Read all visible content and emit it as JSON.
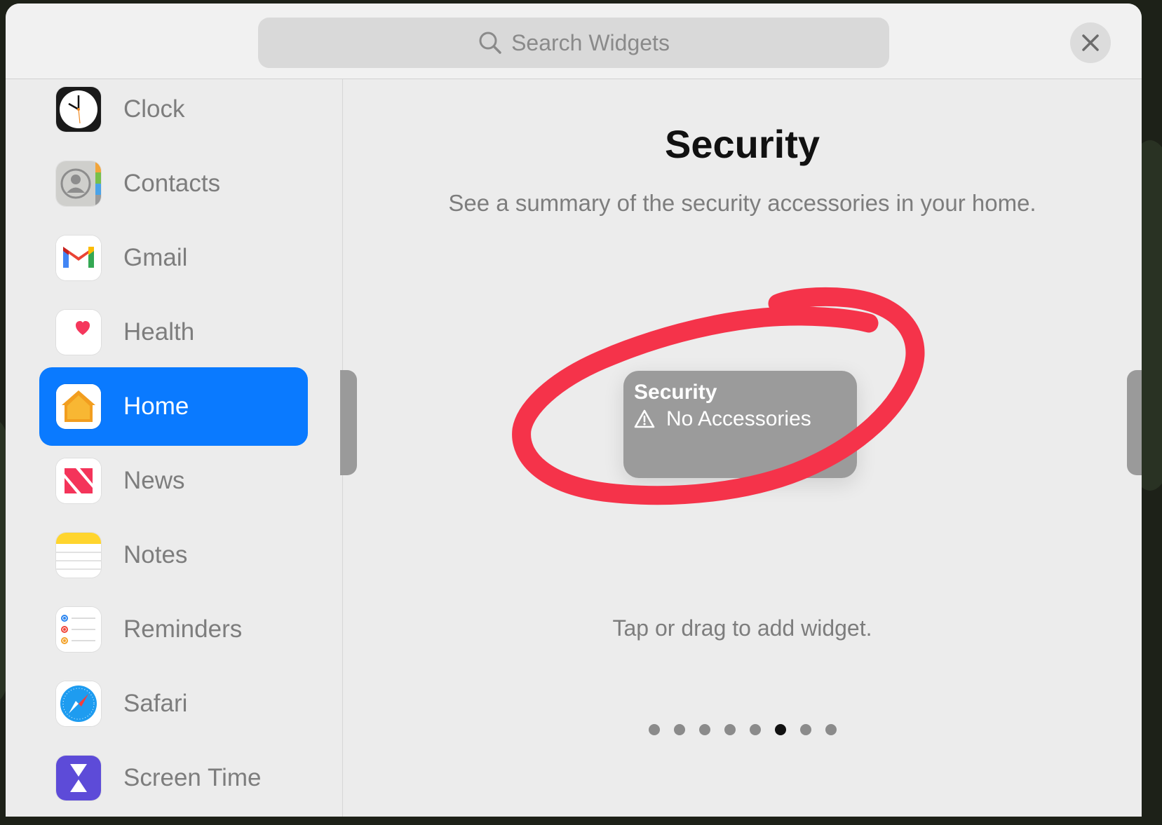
{
  "search": {
    "placeholder": "Search Widgets",
    "icon": "magnifying-glass"
  },
  "close_icon": "xmark",
  "sidebar": {
    "items": [
      {
        "label": "Clock",
        "icon": "clock-app-icon"
      },
      {
        "label": "Contacts",
        "icon": "contacts-app-icon"
      },
      {
        "label": "Gmail",
        "icon": "gmail-app-icon"
      },
      {
        "label": "Health",
        "icon": "health-app-icon"
      },
      {
        "label": "Home",
        "icon": "home-app-icon",
        "selected": true
      },
      {
        "label": "News",
        "icon": "news-app-icon"
      },
      {
        "label": "Notes",
        "icon": "notes-app-icon"
      },
      {
        "label": "Reminders",
        "icon": "reminders-app-icon"
      },
      {
        "label": "Safari",
        "icon": "safari-app-icon"
      },
      {
        "label": "Screen Time",
        "icon": "screen-time-app-icon"
      }
    ]
  },
  "main": {
    "title": "Security",
    "subtitle": "See a summary of the security accessories in your home.",
    "widget": {
      "title": "Security",
      "status": "No Accessories",
      "status_icon": "warning-triangle"
    },
    "hint": "Tap or drag to add widget.",
    "pager": {
      "count": 8,
      "active_index": 5
    }
  },
  "colors": {
    "selected": "#0a7aff",
    "annotation": "#f5334a",
    "widget_bg": "#9b9b9b"
  }
}
